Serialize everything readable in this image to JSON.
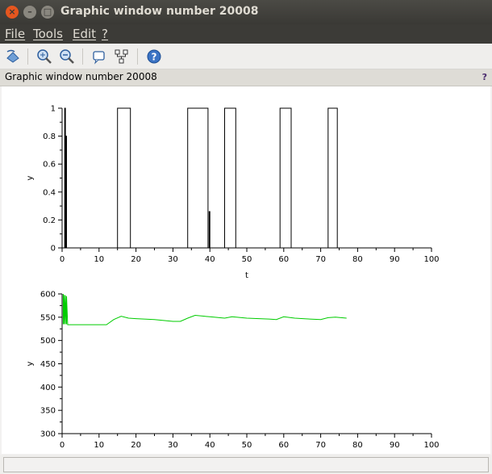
{
  "window": {
    "title": "Graphic window number 20008",
    "close_glyph": "×",
    "min_glyph": "–",
    "max_glyph": "□"
  },
  "menu": [
    {
      "label": "File"
    },
    {
      "label": "Tools"
    },
    {
      "label": "Edit"
    },
    {
      "label": "?"
    }
  ],
  "toolbar": {
    "icons": [
      "rotate-icon",
      "zoom-in-icon",
      "zoom-out-icon",
      "datatip-icon",
      "editor-icon",
      "help-icon"
    ]
  },
  "infobar": {
    "text": "Graphic window number 20008",
    "help": "?"
  },
  "colors": {
    "series_top": "#000000",
    "series_bottom": "#00cc00"
  },
  "chart_data": [
    {
      "type": "line",
      "title": "",
      "xlabel": "t",
      "ylabel": "y",
      "xlim": [
        0,
        100
      ],
      "ylim": [
        0,
        1
      ],
      "xticks": [
        "0",
        "10",
        "20",
        "30",
        "40",
        "50",
        "60",
        "70",
        "80",
        "90",
        "100"
      ],
      "yticks": [
        "0",
        "0.2",
        "0.4",
        "0.6",
        "0.8",
        "1"
      ],
      "series": [
        {
          "x": [
            0,
            0.7,
            0.7,
            0.9,
            0.9,
            1.0,
            1.0,
            1.2,
            1.2,
            15,
            15,
            18.5,
            18.5,
            34,
            34,
            39.5,
            39.5,
            39.8,
            39.8,
            40,
            40,
            44,
            44,
            47,
            47,
            59,
            59,
            62,
            62,
            72,
            72,
            74.5,
            74.5,
            100
          ],
          "y": [
            0,
            0,
            1,
            1,
            0,
            0,
            0.8,
            0.8,
            0,
            0,
            1,
            1,
            0,
            0,
            1,
            1,
            0,
            0,
            0.26,
            0.26,
            0,
            0,
            1,
            1,
            0,
            0,
            1,
            1,
            0,
            0,
            1,
            1,
            0,
            0
          ]
        }
      ]
    },
    {
      "type": "line",
      "title": "",
      "xlabel": "",
      "ylabel": "y",
      "xlim": [
        0,
        100
      ],
      "ylim": [
        300,
        600
      ],
      "xticks": [
        "0",
        "10",
        "20",
        "30",
        "40",
        "50",
        "60",
        "70",
        "80",
        "90",
        "100"
      ],
      "yticks": [
        "300",
        "350",
        "400",
        "450",
        "500",
        "550",
        "600"
      ],
      "series": [
        {
          "x": [
            0.3,
            0.3,
            0.6,
            0.6,
            0.9,
            0.9,
            1.2,
            1.2,
            1.5,
            12,
            14,
            16,
            18,
            20,
            25,
            30,
            32,
            34,
            36,
            40,
            44,
            46,
            50,
            56,
            58,
            60,
            63,
            67,
            70,
            72,
            74,
            77
          ],
          "y": [
            535,
            600,
            535,
            598,
            535,
            597,
            535,
            595,
            534,
            534,
            545,
            552,
            548,
            547,
            545,
            541,
            541,
            548,
            554,
            551,
            548,
            551,
            548,
            546,
            545,
            551,
            548,
            546,
            545,
            549,
            550,
            548
          ]
        }
      ]
    }
  ]
}
